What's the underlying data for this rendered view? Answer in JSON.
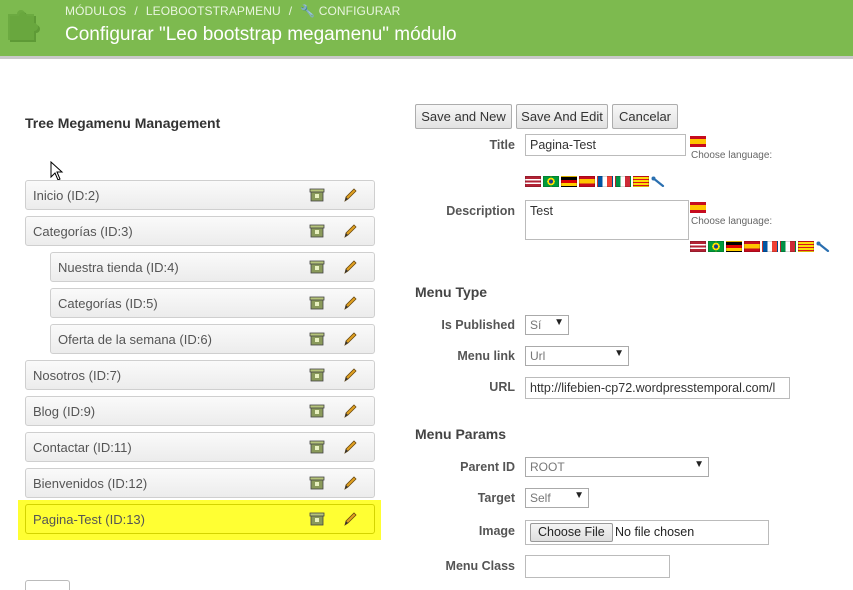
{
  "header": {
    "breadcrumb": [
      "MÓDULOS",
      "LEOBOOTSTRAPMENU",
      "CONFIGURAR"
    ],
    "title": "Configurar \"Leo bootstrap megamenu\" módulo",
    "background": "#7dba4f"
  },
  "tree": {
    "title": "Tree Megamenu Management",
    "items": [
      {
        "label": "Inicio (ID:2)",
        "indent": false,
        "highlighted": false
      },
      {
        "label": "Categorías (ID:3)",
        "indent": false,
        "highlighted": false
      },
      {
        "label": "Nuestra tienda (ID:4)",
        "indent": true,
        "highlighted": false
      },
      {
        "label": "Categorías (ID:5)",
        "indent": true,
        "highlighted": false
      },
      {
        "label": "Oferta de la semana (ID:6)",
        "indent": true,
        "highlighted": false
      },
      {
        "label": "Nosotros (ID:7)",
        "indent": false,
        "highlighted": false
      },
      {
        "label": "Blog (ID:9)",
        "indent": false,
        "highlighted": false
      },
      {
        "label": "Contactar (ID:11)",
        "indent": false,
        "highlighted": false
      },
      {
        "label": "Bienvenidos (ID:12)",
        "indent": false,
        "highlighted": false
      },
      {
        "label": "Pagina-Test (ID:13)",
        "indent": false,
        "highlighted": true
      }
    ],
    "highlight_color": "#ffff33"
  },
  "toolbar": {
    "save_new": "Save and New",
    "save_edit": "Save And Edit",
    "cancel": "Cancelar"
  },
  "form": {
    "title_label": "Title",
    "title_value": "Pagina-Test",
    "description_label": "Description",
    "description_value": "Test",
    "choose_language": "Choose language:",
    "menu_type_heading": "Menu Type",
    "is_published_label": "Is Published",
    "is_published_value": "Sí",
    "menu_link_label": "Menu link",
    "menu_link_value": "Url",
    "url_label": "URL",
    "url_value": "http://lifebien-cp72.wordpresstemporal.com/l",
    "menu_params_heading": "Menu Params",
    "parent_id_label": "Parent ID",
    "parent_id_value": "ROOT",
    "target_label": "Target",
    "target_value": "Self",
    "image_label": "Image",
    "choose_file": "Choose File",
    "no_file": "No file chosen",
    "menu_class_label": "Menu Class"
  },
  "flags": [
    "us-flag-icon",
    "br-flag-icon",
    "de-flag-icon",
    "es-flag-icon",
    "fr-flag-icon",
    "it-flag-icon",
    "ca-flag-icon"
  ]
}
